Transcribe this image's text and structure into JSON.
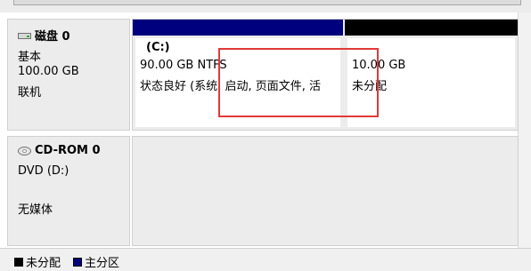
{
  "disks": [
    {
      "name": "磁盘 0",
      "icon": "hard-disk-icon",
      "type": "基本",
      "size": "100.00 GB",
      "status": "联机",
      "partitions": [
        {
          "kind": "primary",
          "bar_color": "#00007f",
          "drive": "(C:)",
          "size_fs": "90.00 GB NTFS",
          "status": "状态良好 (系统, 启动, 页面文件, 活"
        },
        {
          "kind": "unallocated",
          "bar_color": "#000000",
          "size": "10.00 GB",
          "status": "未分配"
        }
      ]
    },
    {
      "name": "CD-ROM 0",
      "icon": "cd-rom-icon",
      "type": "DVD (D:)",
      "status": "无媒体"
    }
  ],
  "legend": [
    {
      "label": "未分配",
      "color": "#000000"
    },
    {
      "label": "主分区",
      "color": "#00007f"
    }
  ],
  "highlight_color": "#e03a3a"
}
